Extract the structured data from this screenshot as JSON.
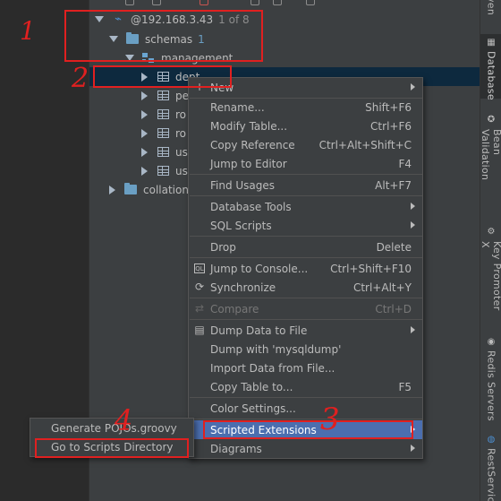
{
  "tree": {
    "connection": {
      "label": "@192.168.3.43",
      "count": "1 of 8"
    },
    "schemas": {
      "label": "schemas",
      "count": "1"
    },
    "management": {
      "label": "management"
    },
    "tables": [
      "dept",
      "pe",
      "ro",
      "ro",
      "us",
      "us"
    ],
    "collation": {
      "label": "collation"
    }
  },
  "annotations": {
    "n1": "1",
    "n2": "2",
    "n3": "3",
    "n4": "4"
  },
  "context_menu": {
    "items": [
      {
        "label": "New",
        "shortcut": "",
        "submenu": true,
        "icon": "plus-icon"
      },
      {
        "label": "Rename...",
        "shortcut": "Shift+F6"
      },
      {
        "label": "Modify Table...",
        "shortcut": "Ctrl+F6"
      },
      {
        "label": "Copy Reference",
        "shortcut": "Ctrl+Alt+Shift+C"
      },
      {
        "label": "Jump to Editor",
        "shortcut": "F4"
      },
      {
        "label": "Find Usages",
        "shortcut": "Alt+F7"
      },
      {
        "label": "Database Tools",
        "shortcut": "",
        "submenu": true
      },
      {
        "label": "SQL Scripts",
        "shortcut": "",
        "submenu": true
      },
      {
        "label": "Drop",
        "shortcut": "Delete"
      },
      {
        "label": "Jump to Console...",
        "shortcut": "Ctrl+Shift+F10",
        "icon": "console-icon"
      },
      {
        "label": "Synchronize",
        "shortcut": "Ctrl+Alt+Y",
        "icon": "sync-icon"
      },
      {
        "label": "Compare",
        "shortcut": "Ctrl+D",
        "icon": "compare-icon",
        "disabled": true
      },
      {
        "label": "Dump Data to File",
        "shortcut": "",
        "submenu": true,
        "icon": "dump-icon"
      },
      {
        "label": "Dump with 'mysqldump'",
        "shortcut": ""
      },
      {
        "label": "Import Data from File...",
        "shortcut": ""
      },
      {
        "label": "Copy Table to...",
        "shortcut": "F5"
      },
      {
        "label": "Color Settings...",
        "shortcut": ""
      },
      {
        "label": "Scripted Extensions",
        "shortcut": "",
        "submenu": true,
        "highlighted": true
      },
      {
        "label": "Diagrams",
        "shortcut": "",
        "submenu": true
      }
    ]
  },
  "submenu": {
    "items": [
      {
        "label": "Generate POJOs.groovy"
      },
      {
        "label": "Go to Scripts Directory"
      }
    ]
  },
  "right_toolbar": {
    "tabs": [
      {
        "label": "ven"
      },
      {
        "label": "Database",
        "icon": "database-icon"
      },
      {
        "label": "Bean Validation",
        "icon": "bean-icon"
      },
      {
        "label": "Key Promoter X",
        "icon": "key-icon"
      },
      {
        "label": "Redis Servers",
        "icon": "redis-icon"
      },
      {
        "label": "RestServic",
        "icon": "rest-icon"
      }
    ]
  },
  "colors": {
    "selection": "#0d293e",
    "highlight": "#4b6eaf",
    "annotation": "#e02020",
    "panel": "#3c3f41"
  }
}
